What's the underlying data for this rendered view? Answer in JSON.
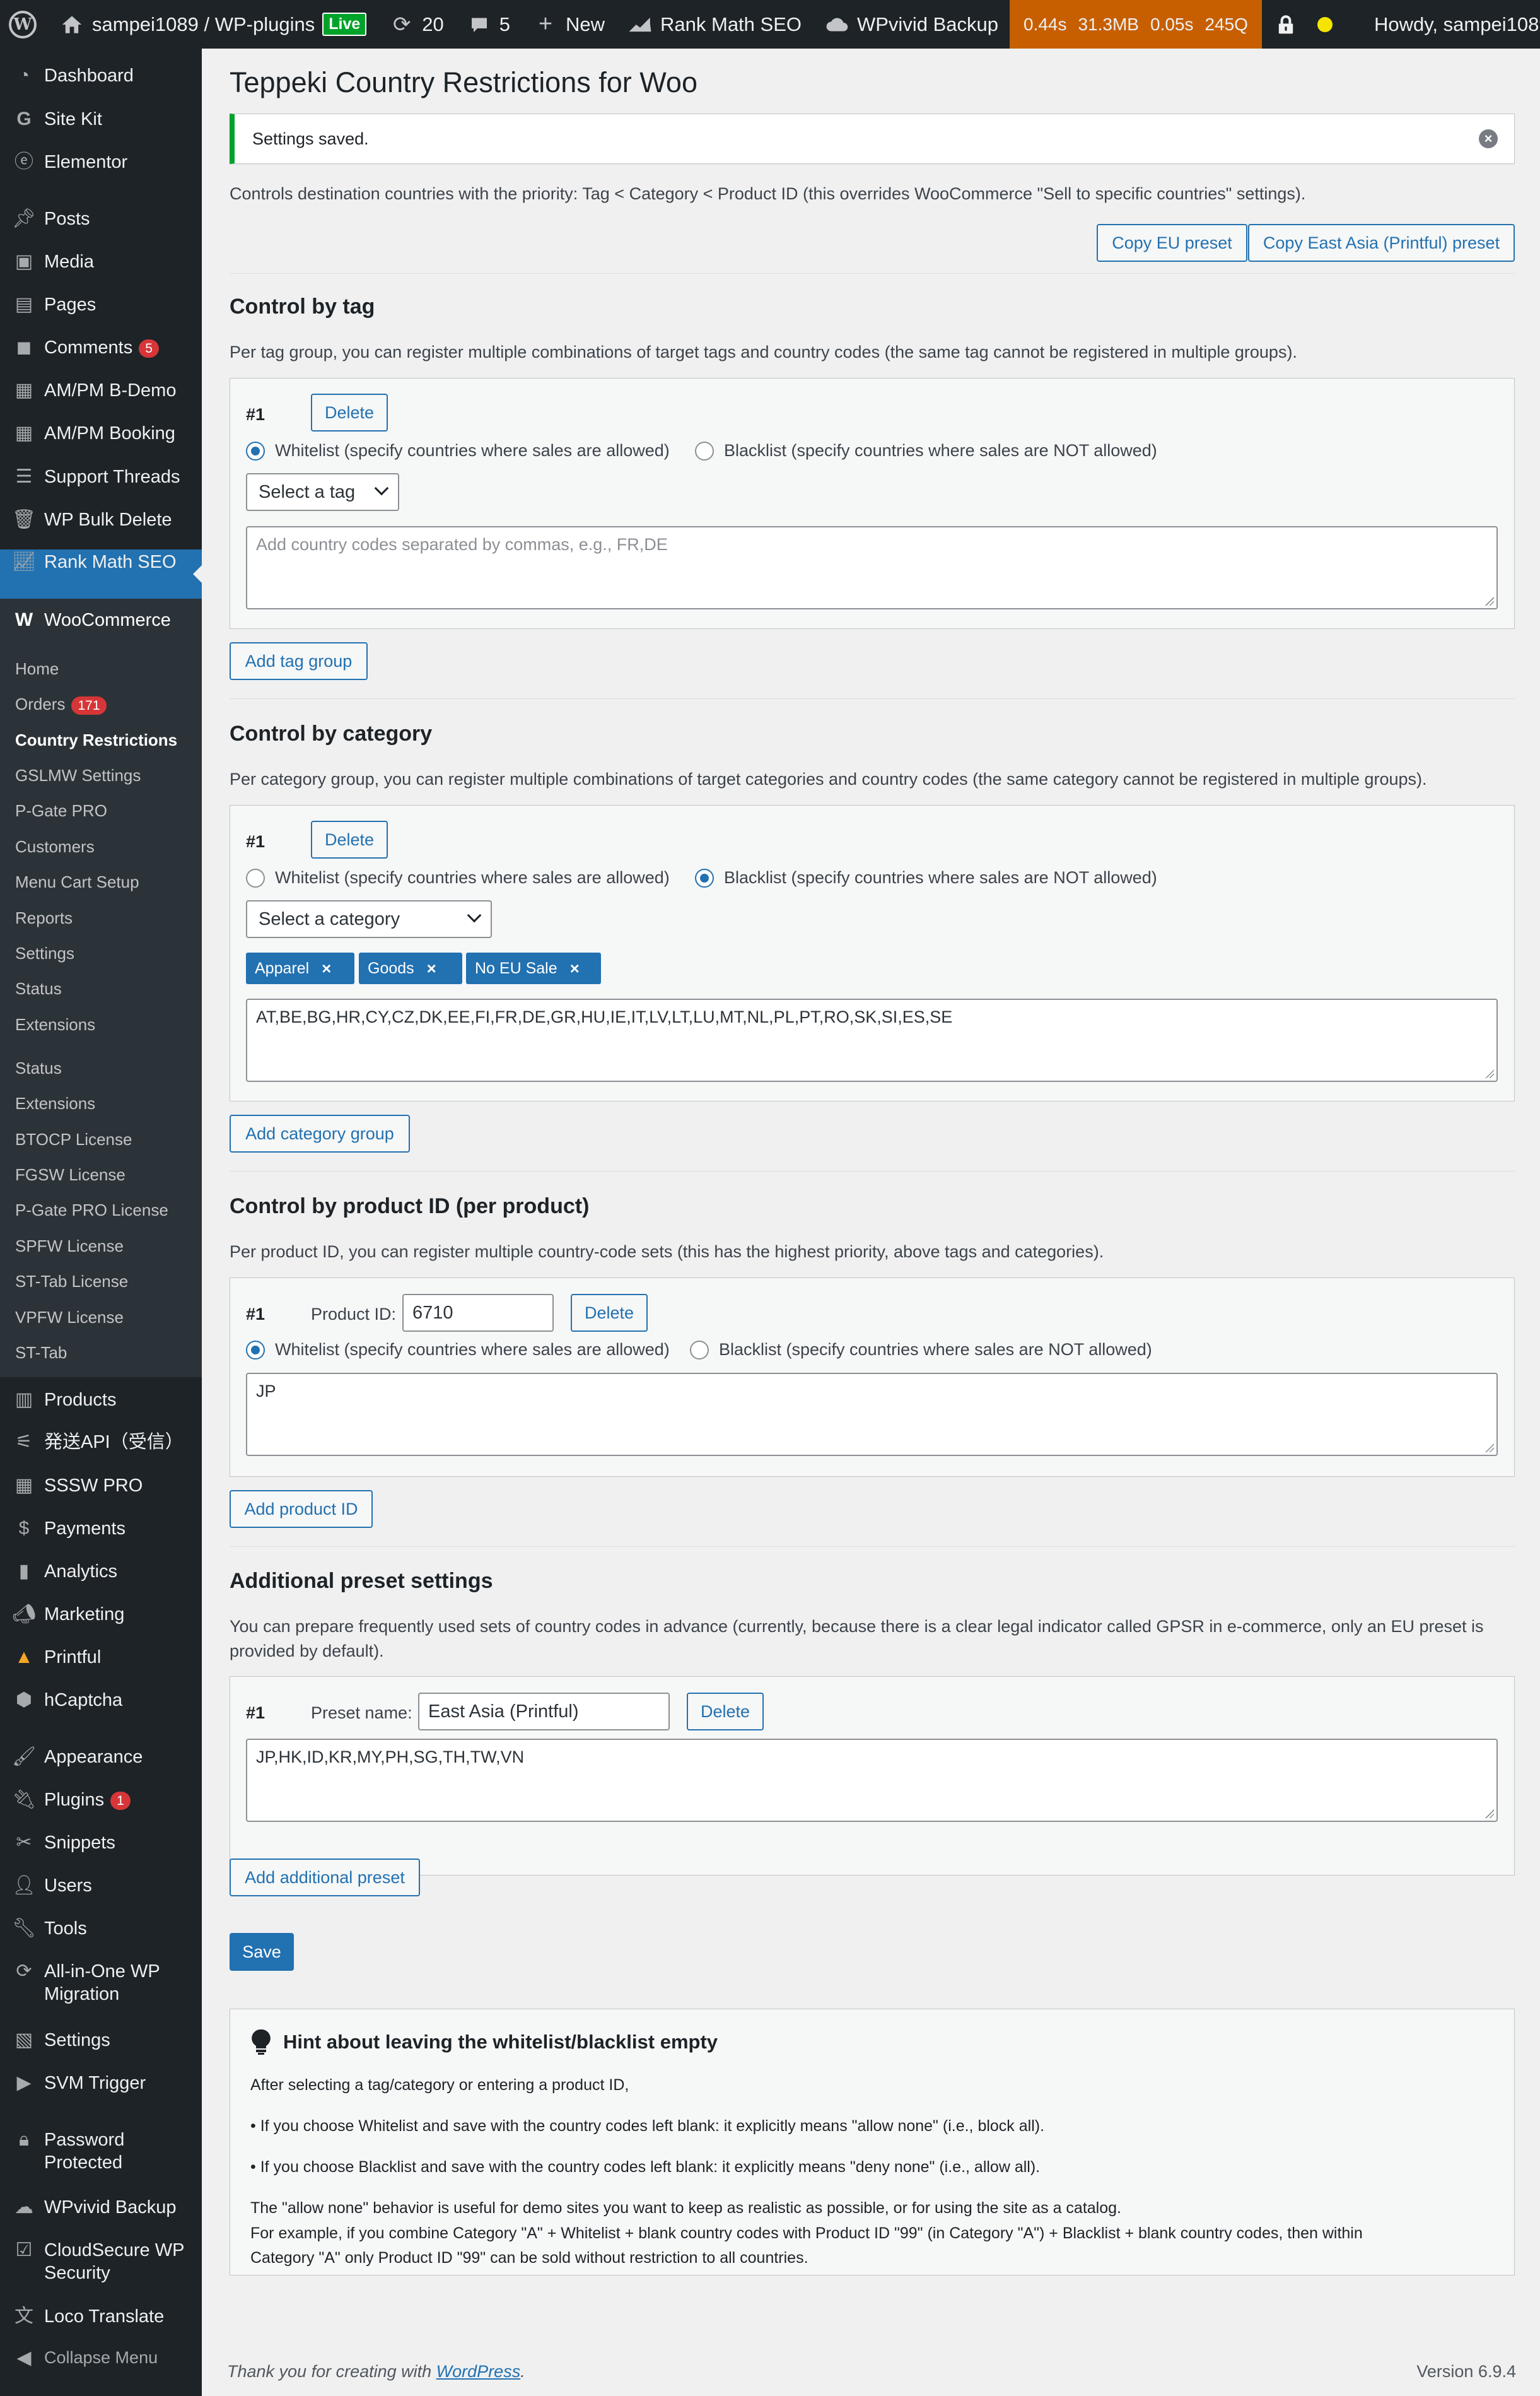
{
  "adminbar": {
    "site_name": "sampei1089 / WP-plugins",
    "live_label": "Live",
    "updates_count": "20",
    "comments_count": "5",
    "new_label": "New",
    "rankmath_label": "Rank Math SEO",
    "wpvivid_label": "WPvivid Backup",
    "qm_time": "0.44s",
    "qm_memory": "31.3MB",
    "qm_db_time": "0.05s",
    "qm_queries": "245Q",
    "howdy": "Howdy, sampei1089"
  },
  "sidebar": {
    "dashboard": "Dashboard",
    "sitekit": "Site Kit",
    "elementor": "Elementor",
    "posts": "Posts",
    "media": "Media",
    "pages": "Pages",
    "comments": "Comments",
    "comments_badge": "5",
    "ampm_bdemo": "AM/PM B-Demo",
    "ampm_booking": "AM/PM Booking",
    "support_threads": "Support Threads",
    "wp_bulk_delete": "WP Bulk Delete",
    "rank_math": "Rank Math SEO",
    "woocommerce": "WooCommerce",
    "woo_sub": {
      "home": "Home",
      "orders": "Orders",
      "orders_badge": "171",
      "country_restrictions": "Country Restrictions",
      "gslmw": "GSLMW Settings",
      "pgate": "P-Gate PRO",
      "customers": "Customers",
      "menu_cart": "Menu Cart Setup",
      "reports": "Reports",
      "settings": "Settings",
      "status": "Status",
      "extensions": "Extensions",
      "status2": "Status",
      "extensions2": "Extensions",
      "btocp": "BTOCP License",
      "fgsw": "FGSW License",
      "pgate_license": "P-Gate PRO License",
      "spfw": "SPFW License",
      "sttab_license": "ST-Tab License",
      "vpfw": "VPFW License",
      "sttab": "ST-Tab"
    },
    "products": "Products",
    "shipping_api": "発送API（受信）",
    "sssw": "SSSW PRO",
    "payments": "Payments",
    "analytics": "Analytics",
    "marketing": "Marketing",
    "printful": "Printful",
    "hcaptcha": "hCaptcha",
    "appearance": "Appearance",
    "plugins": "Plugins",
    "plugins_badge": "1",
    "snippets": "Snippets",
    "users": "Users",
    "tools": "Tools",
    "aio_line1": "All-in-One WP",
    "aio_line2": "Migration",
    "settings": "Settings",
    "svm": "SVM Trigger",
    "pp_line1": "Password",
    "pp_line2": "Protected",
    "wpvivid": "WPvivid Backup",
    "cs_line1": "CloudSecure WP",
    "cs_line2": "Security",
    "loco": "Loco Translate",
    "collapse": "Collapse Menu"
  },
  "page": {
    "title": "Teppeki Country Restrictions for Woo",
    "notice": "Settings saved.",
    "intro": "Controls destination countries with the priority: Tag < Category < Product ID (this overrides WooCommerce \"Sell to specific countries\" settings).",
    "copy_eu": "Copy EU preset",
    "copy_ea": "Copy East Asia (Printful) preset"
  },
  "tag_section": {
    "title": "Control by tag",
    "desc": "Per tag group, you can register multiple combinations of target tags and country codes (the same tag cannot be registered in multiple groups).",
    "group_num": "#1",
    "delete": "Delete",
    "whitelist": "Whitelist (specify countries where sales are allowed)",
    "blacklist": "Blacklist (specify countries where sales are NOT allowed)",
    "select_value": "Select a tag",
    "codes_placeholder": "Add country codes separated by commas, e.g., FR,DE",
    "add": "Add tag group"
  },
  "category_section": {
    "title": "Control by category",
    "desc": "Per category group, you can register multiple combinations of target categories and country codes (the same category cannot be registered in multiple groups).",
    "group_num": "#1",
    "delete": "Delete",
    "whitelist": "Whitelist (specify countries where sales are allowed)",
    "blacklist": "Blacklist (specify countries where sales are NOT allowed)",
    "select_value": "Select a category",
    "chips": [
      "Apparel",
      "Goods",
      "No EU Sale"
    ],
    "chip_remove": "×",
    "codes": "AT,BE,BG,HR,CY,CZ,DK,EE,FI,FR,DE,GR,HU,IE,IT,LV,LT,LU,MT,NL,PL,PT,RO,SK,SI,ES,SE",
    "add": "Add category group"
  },
  "product_section": {
    "title": "Control by product ID (per product)",
    "desc": "Per product ID, you can register multiple country-code sets (this has the highest priority, above tags and categories).",
    "group_num": "#1",
    "product_id_label": "Product ID:",
    "product_id_value": "6710",
    "delete": "Delete",
    "whitelist": "Whitelist (specify countries where sales are allowed)",
    "blacklist": "Blacklist (specify countries where sales are NOT allowed)",
    "codes": "JP",
    "add": "Add product ID"
  },
  "preset_section": {
    "title": "Additional preset settings",
    "desc_line1": "You can prepare frequently used sets of country codes in advance (currently, because there is a clear legal indicator called GPSR in e-commerce, only an EU preset is",
    "desc_line2": "provided by default).",
    "group_num": "#1",
    "preset_name_label": "Preset name:",
    "preset_name_value": "East Asia (Printful)",
    "delete": "Delete",
    "codes": "JP,HK,ID,KR,MY,PH,SG,TH,TW,VN",
    "add": "Add additional preset"
  },
  "save": "Save",
  "hint": {
    "title": "Hint about leaving the whitelist/blacklist empty",
    "line1": "After selecting a tag/category or entering a product ID,",
    "line2": "• If you choose Whitelist and save with the country codes left blank: it explicitly means \"allow none\" (i.e., block all).",
    "line3": "• If you choose Blacklist and save with the country codes left blank: it explicitly means \"deny none\" (i.e., allow all).",
    "line4": "The \"allow none\" behavior is useful for demo sites you want to keep as realistic as possible, or for using the site as a catalog.",
    "line5": "For example, if you combine Category \"A\" + Whitelist + blank country codes with Product ID \"99\" (in Category \"A\") + Blacklist + blank country codes, then within",
    "line6": "Category \"A\" only Product ID \"99\" can be sold without restriction to all countries."
  },
  "footer": {
    "thanks_prefix": "Thank you for creating with ",
    "wordpress_link": "WordPress",
    "thanks_suffix": ".",
    "version": "Version 6.9.4"
  }
}
